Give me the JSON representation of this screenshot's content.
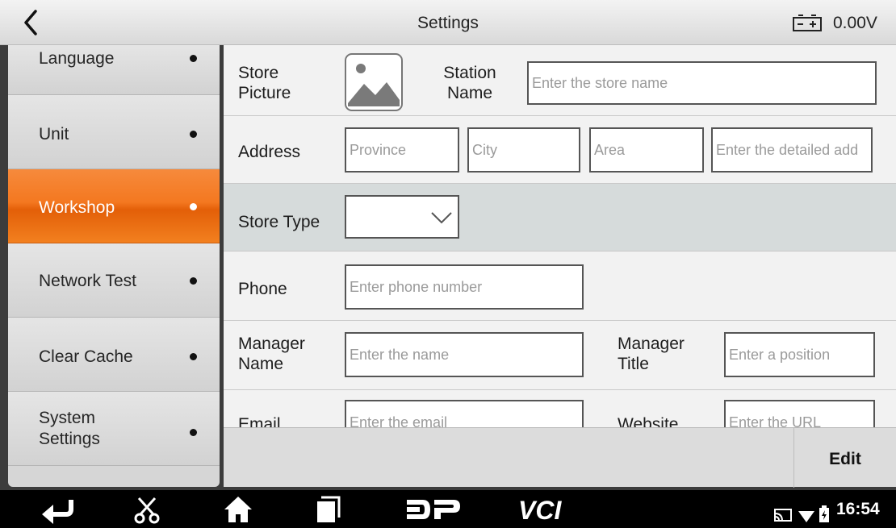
{
  "header": {
    "title": "Settings",
    "voltage": "0.00V"
  },
  "sidebar": {
    "items": [
      {
        "label": "Language",
        "active": false
      },
      {
        "label": "Unit",
        "active": false
      },
      {
        "label": "Workshop",
        "active": true
      },
      {
        "label": "Network Test",
        "active": false
      },
      {
        "label": "Clear Cache",
        "active": false
      },
      {
        "label": "System Settings",
        "active": false
      }
    ]
  },
  "form": {
    "store_picture_label": "Store Picture",
    "station_name_label": "Station Name",
    "station_name_placeholder": "Enter the store name",
    "address_label": "Address",
    "province_placeholder": "Province",
    "city_placeholder": "City",
    "area_placeholder": "Area",
    "detailed_address_placeholder": "Enter the detailed add",
    "store_type_label": "Store Type",
    "store_type_value": "",
    "phone_label": "Phone",
    "phone_placeholder": "Enter phone number",
    "manager_name_label": "Manager Name",
    "manager_name_placeholder": "Enter the name",
    "manager_title_label": "Manager Title",
    "manager_title_placeholder": "Enter a position",
    "email_label": "Email",
    "email_placeholder": "Enter the email",
    "website_label": "Website",
    "website_placeholder": "Enter the URL"
  },
  "actions": {
    "edit_label": "Edit"
  },
  "navbar": {
    "time": "16:54",
    "brand_left": "DP",
    "brand_right": "VCI"
  },
  "colors": {
    "accent": "#f47820",
    "header_bg": "#e6e6e6",
    "navbar_bg": "#000000"
  }
}
